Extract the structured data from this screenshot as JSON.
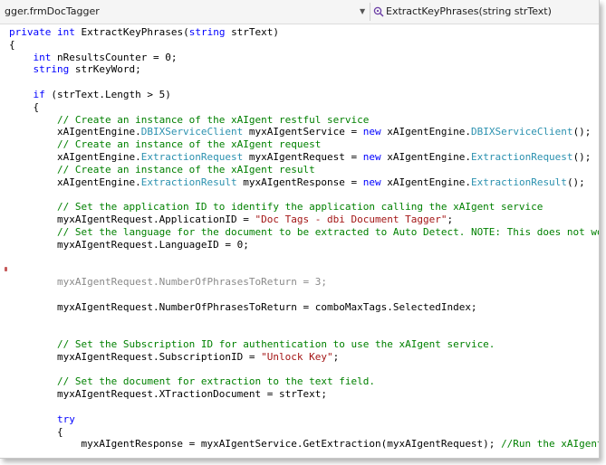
{
  "navbar": {
    "class_selector": "gger.frmDocTagger",
    "class_selector_arrow": "▼",
    "member_selector": "ExtractKeyPhrases(string strText)",
    "member_icon": "method-icon"
  },
  "code_lines": [
    [
      [
        "kw",
        "private int "
      ],
      [
        "p",
        "ExtractKeyPhrases("
      ],
      [
        "kw",
        "string "
      ],
      [
        "p",
        "strText)"
      ]
    ],
    [
      [
        "p",
        "{"
      ]
    ],
    [
      [
        "p",
        "    "
      ],
      [
        "kw",
        "int "
      ],
      [
        "p",
        "nResultsCounter = 0;"
      ]
    ],
    [
      [
        "p",
        "    "
      ],
      [
        "kw",
        "string "
      ],
      [
        "p",
        "strKeyWord;"
      ]
    ],
    [],
    [
      [
        "p",
        "    "
      ],
      [
        "kw",
        "if "
      ],
      [
        "p",
        "(strText.Length > 5)"
      ]
    ],
    [
      [
        "p",
        "    {"
      ]
    ],
    [
      [
        "p",
        "        "
      ],
      [
        "cm",
        "// Create an instance of the xAIgent restful service"
      ]
    ],
    [
      [
        "p",
        "        xAIgentEngine."
      ],
      [
        "ty",
        "DBIXServiceClient"
      ],
      [
        "p",
        " myxAIgentService = "
      ],
      [
        "kw",
        "new "
      ],
      [
        "p",
        "xAIgentEngine."
      ],
      [
        "ty",
        "DBIXServiceClient"
      ],
      [
        "p",
        "();"
      ]
    ],
    [
      [
        "p",
        "        "
      ],
      [
        "cm",
        "// Create an instance of the xAIgent request"
      ]
    ],
    [
      [
        "p",
        "        xAIgentEngine."
      ],
      [
        "ty",
        "ExtractionRequest"
      ],
      [
        "p",
        " myxAIgentRequest = "
      ],
      [
        "kw",
        "new "
      ],
      [
        "p",
        "xAIgentEngine."
      ],
      [
        "ty",
        "ExtractionRequest"
      ],
      [
        "p",
        "();"
      ]
    ],
    [
      [
        "p",
        "        "
      ],
      [
        "cm",
        "// Create an instance of the xAIgent result"
      ]
    ],
    [
      [
        "p",
        "        xAIgentEngine."
      ],
      [
        "ty",
        "ExtractionResult"
      ],
      [
        "p",
        " myxAIgentResponse = "
      ],
      [
        "kw",
        "new "
      ],
      [
        "p",
        "xAIgentEngine."
      ],
      [
        "ty",
        "ExtractionResult"
      ],
      [
        "p",
        "();"
      ]
    ],
    [],
    [
      [
        "p",
        "        "
      ],
      [
        "cm",
        "// Set the application ID to identify the application calling the xAIgent service"
      ]
    ],
    [
      [
        "p",
        "        myxAIgentRequest.ApplicationID = "
      ],
      [
        "st",
        "\"Doc Tags - dbi Document Tagger\""
      ],
      [
        "p",
        ";"
      ]
    ],
    [
      [
        "p",
        "        "
      ],
      [
        "cm",
        "// Set the language for the document to be extracted to Auto Detect. NOTE: This does not work with"
      ]
    ],
    [
      [
        "p",
        "        myxAIgentRequest.LanguageID = 0;"
      ]
    ],
    [],
    [],
    [
      [
        "p",
        "        "
      ],
      [
        "dim",
        "myxAIgentRequest.NumberOfPhrasesToReturn = 3;"
      ]
    ],
    [],
    [
      [
        "p",
        "        myxAIgentRequest.NumberOfPhrasesToReturn = comboMaxTags.SelectedIndex;"
      ]
    ],
    [],
    [],
    [
      [
        "p",
        "        "
      ],
      [
        "cm",
        "// Set the Subscription ID for authentication to use the xAIgent service."
      ]
    ],
    [
      [
        "p",
        "        myxAIgentRequest.SubscriptionID = "
      ],
      [
        "st",
        "\"Unlock Key\""
      ],
      [
        "p",
        ";"
      ]
    ],
    [],
    [
      [
        "p",
        "        "
      ],
      [
        "cm",
        "// Set the document for extraction to the text field."
      ]
    ],
    [
      [
        "p",
        "        myxAIgentRequest.XTractionDocument = strText;"
      ]
    ],
    [],
    [
      [
        "p",
        "        "
      ],
      [
        "kw",
        "try"
      ]
    ],
    [
      [
        "p",
        "        {"
      ]
    ],
    [
      [
        "p",
        "            myxAIgentResponse = myxAIgentService.GetExtraction(myxAIgentRequest); "
      ],
      [
        "cm",
        "//Run the xAIgent Service"
      ]
    ]
  ]
}
